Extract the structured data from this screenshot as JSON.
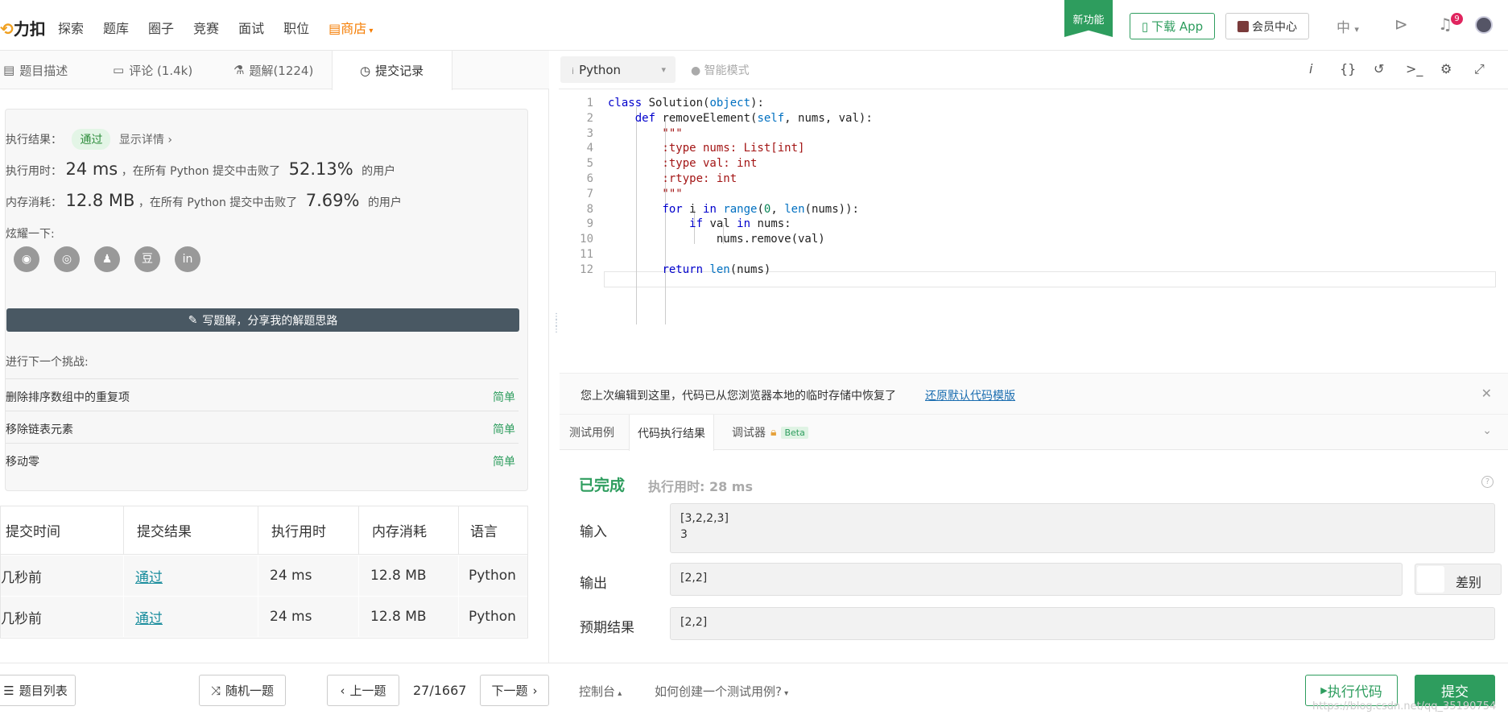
{
  "nav": {
    "logo": "力扣",
    "items": [
      "探索",
      "题库",
      "圈子",
      "竞赛",
      "面试",
      "职位"
    ],
    "shop": "商店",
    "new_feature": "新功能",
    "download": "下载 App",
    "vip": "会员中心",
    "lang": "中",
    "notif_count": "9"
  },
  "left_tabs": [
    {
      "label": "题目描述"
    },
    {
      "label": "评论 (1.4k)"
    },
    {
      "label": "题解(1224)"
    },
    {
      "label": "提交记录"
    }
  ],
  "editor_bar": {
    "language": "Python",
    "smart_mode": "智能模式",
    "icons": [
      "info-icon",
      "braces-icon",
      "reset-icon",
      "terminal-icon",
      "settings-icon",
      "fullscreen-icon"
    ]
  },
  "result": {
    "label_result": "执行结果：",
    "status": "通过",
    "show_details": "显示详情 ›",
    "label_time": "执行用时：",
    "time": "24 ms",
    "time_text": "，在所有 Python 提交中击败了",
    "time_pct": "52.13%",
    "users": "的用户",
    "label_mem": "内存消耗：",
    "mem": "12.8 MB",
    "mem_text": "，在所有 Python 提交中击败了",
    "mem_pct": "7.69%",
    "share_label": "炫耀一下:",
    "share_icons": [
      "wechat-icon",
      "weibo-icon",
      "qq-icon",
      "douban-icon",
      "linkedin-icon"
    ],
    "write_btn": "写题解，分享我的解题思路",
    "next_label": "进行下一个挑战:",
    "next": [
      {
        "title": "删除排序数组中的重复项",
        "difficulty": "简单"
      },
      {
        "title": "移除链表元素",
        "difficulty": "简单"
      },
      {
        "title": "移动零",
        "difficulty": "简单"
      }
    ]
  },
  "submissions": {
    "headers": [
      "提交时间",
      "提交结果",
      "执行用时",
      "内存消耗",
      "语言"
    ],
    "rows": [
      [
        "几秒前",
        "通过",
        "24 ms",
        "12.8 MB",
        "Python"
      ],
      [
        "几秒前",
        "通过",
        "24 ms",
        "12.8 MB",
        "Python"
      ]
    ]
  },
  "code_lines": [
    "class Solution(object):",
    "    def removeElement(self, nums, val):",
    "        \"\"\"",
    "        :type nums: List[int]",
    "        :type val: int",
    "        :rtype: int",
    "        \"\"\"",
    "        for i in range(0, len(nums)):",
    "            if val in nums:",
    "                nums.remove(val)",
    "",
    "        return len(nums)"
  ],
  "restore": {
    "text": "您上次编辑到这里，代码已从您浏览器本地的临时存储中恢复了",
    "link": "还原默认代码模版"
  },
  "bottom_tabs": [
    "测试用例",
    "代码执行结果",
    "调试器",
    "Beta"
  ],
  "run_result": {
    "status": "已完成",
    "time": "执行用时: 28 ms",
    "input_label": "输入",
    "input": [
      "[3,2,2,3]",
      "3"
    ],
    "output_label": "输出",
    "output": "[2,2]",
    "diff": "差别",
    "expected_label": "预期结果",
    "expected": "[2,2]"
  },
  "footer": {
    "problem_list": "题目列表",
    "random": "随机一题",
    "prev": "上一题",
    "page": "27/1667",
    "next": "下一题",
    "console": "控制台",
    "howto": "如何创建一个测试用例?",
    "run": "执行代码",
    "submit": "提交"
  },
  "watermark": "https://blog.csdn.net/qq_35190754"
}
